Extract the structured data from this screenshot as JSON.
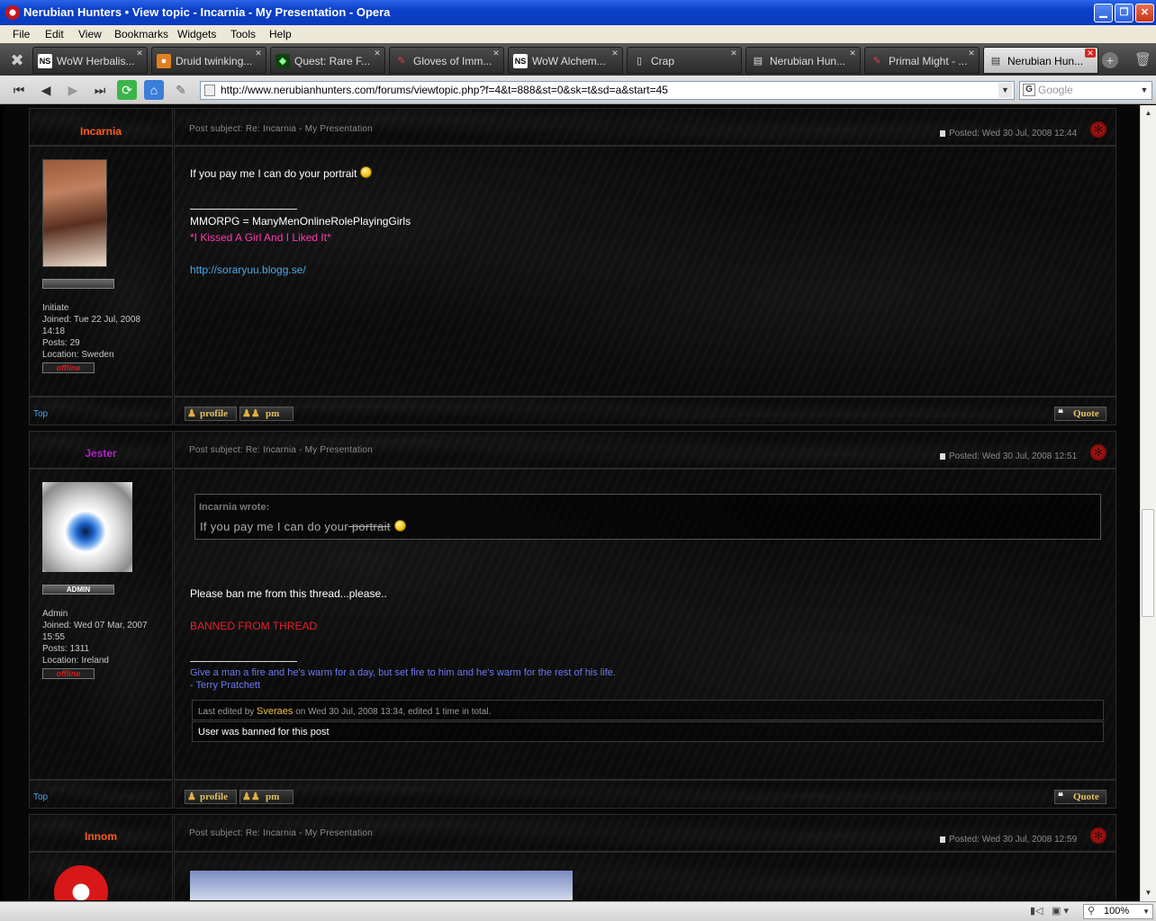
{
  "window": {
    "title": "Nerubian Hunters • View topic - Incarnia - My Presentation - Opera"
  },
  "menu": [
    "File",
    "Edit",
    "View",
    "Bookmarks",
    "Widgets",
    "Tools",
    "Help"
  ],
  "tabs": [
    {
      "label": "WoW Herbalis...",
      "icon": "NS"
    },
    {
      "label": "Druid twinking...",
      "icon": "●"
    },
    {
      "label": "Quest: Rare F...",
      "icon": "◆"
    },
    {
      "label": "Gloves of Imm...",
      "icon": "✎"
    },
    {
      "label": "WoW Alchem...",
      "icon": "NS"
    },
    {
      "label": "Crap",
      "icon": "▯"
    },
    {
      "label": "Nerubian Hun...",
      "icon": "▤"
    },
    {
      "label": "Primal Might - ...",
      "icon": "✎"
    },
    {
      "label": "Nerubian Hun...",
      "icon": "▤",
      "active": true
    }
  ],
  "address": {
    "url": "http://www.nerubianhunters.com/forums/viewtopic.php?f=4&t=888&st=0&sk=t&sd=a&start=45",
    "search_placeholder": "Google"
  },
  "labels": {
    "top": "Top",
    "profile": "profile",
    "pm": "pm",
    "quote": "Quote",
    "offline": "offline",
    "admin": "ADMIN"
  },
  "posts": [
    {
      "author": "Incarnia",
      "author_color": "#ff5a1e",
      "subject": "Post subject: Re: Incarnia - My Presentation",
      "posted": "Posted: Wed 30 Jul, 2008 12:44",
      "rank": "Initiate",
      "joined": "Joined: Tue 22 Jul, 2008",
      "joined2": "14:18",
      "posts": "Posts: 29",
      "location": "Location: Sweden",
      "text": "If you pay me I can do your portrait",
      "sig1": "MMORPG = ManyMenOnlineRolePlayingGirls",
      "sig2": "*I Kissed A Girl And I Liked It*",
      "sig3": "http://soraryuu.blogg.se/"
    },
    {
      "author": "Jester",
      "author_color": "#b020c8",
      "subject": "Post subject: Re: Incarnia - My Presentation",
      "posted": "Posted: Wed 30 Jul, 2008 12:51",
      "rank": "Admin",
      "joined": "Joined: Wed 07 Mar, 2007",
      "joined2": "15:55",
      "posts": "Posts: 1311",
      "location": "Location: Ireland",
      "quote_author": "Incarnia wrote:",
      "quote_text": "If you pay me I can do your",
      "quote_strike": " portrait",
      "text": "Please ban me from this thread...please..",
      "banned": "BANNED FROM THREAD",
      "sig1": "Give a man a fire and he's warm for a day, but set fire to him and he's warm for the rest of his life.",
      "sig2": "- Terry Pratchett",
      "edit_prefix": "Last edited by",
      "edit_user": "Sveraes",
      "edit_suffix": "on Wed 30 Jul, 2008 13:34, edited 1 time in total.",
      "edit_reason": "User was banned for this post"
    },
    {
      "author": "Innom",
      "author_color": "#ff5a1e",
      "subject": "Post subject: Re: Incarnia - My Presentation",
      "posted": "Posted: Wed 30 Jul, 2008 12:59"
    }
  ],
  "status": {
    "zoom": "100%"
  }
}
